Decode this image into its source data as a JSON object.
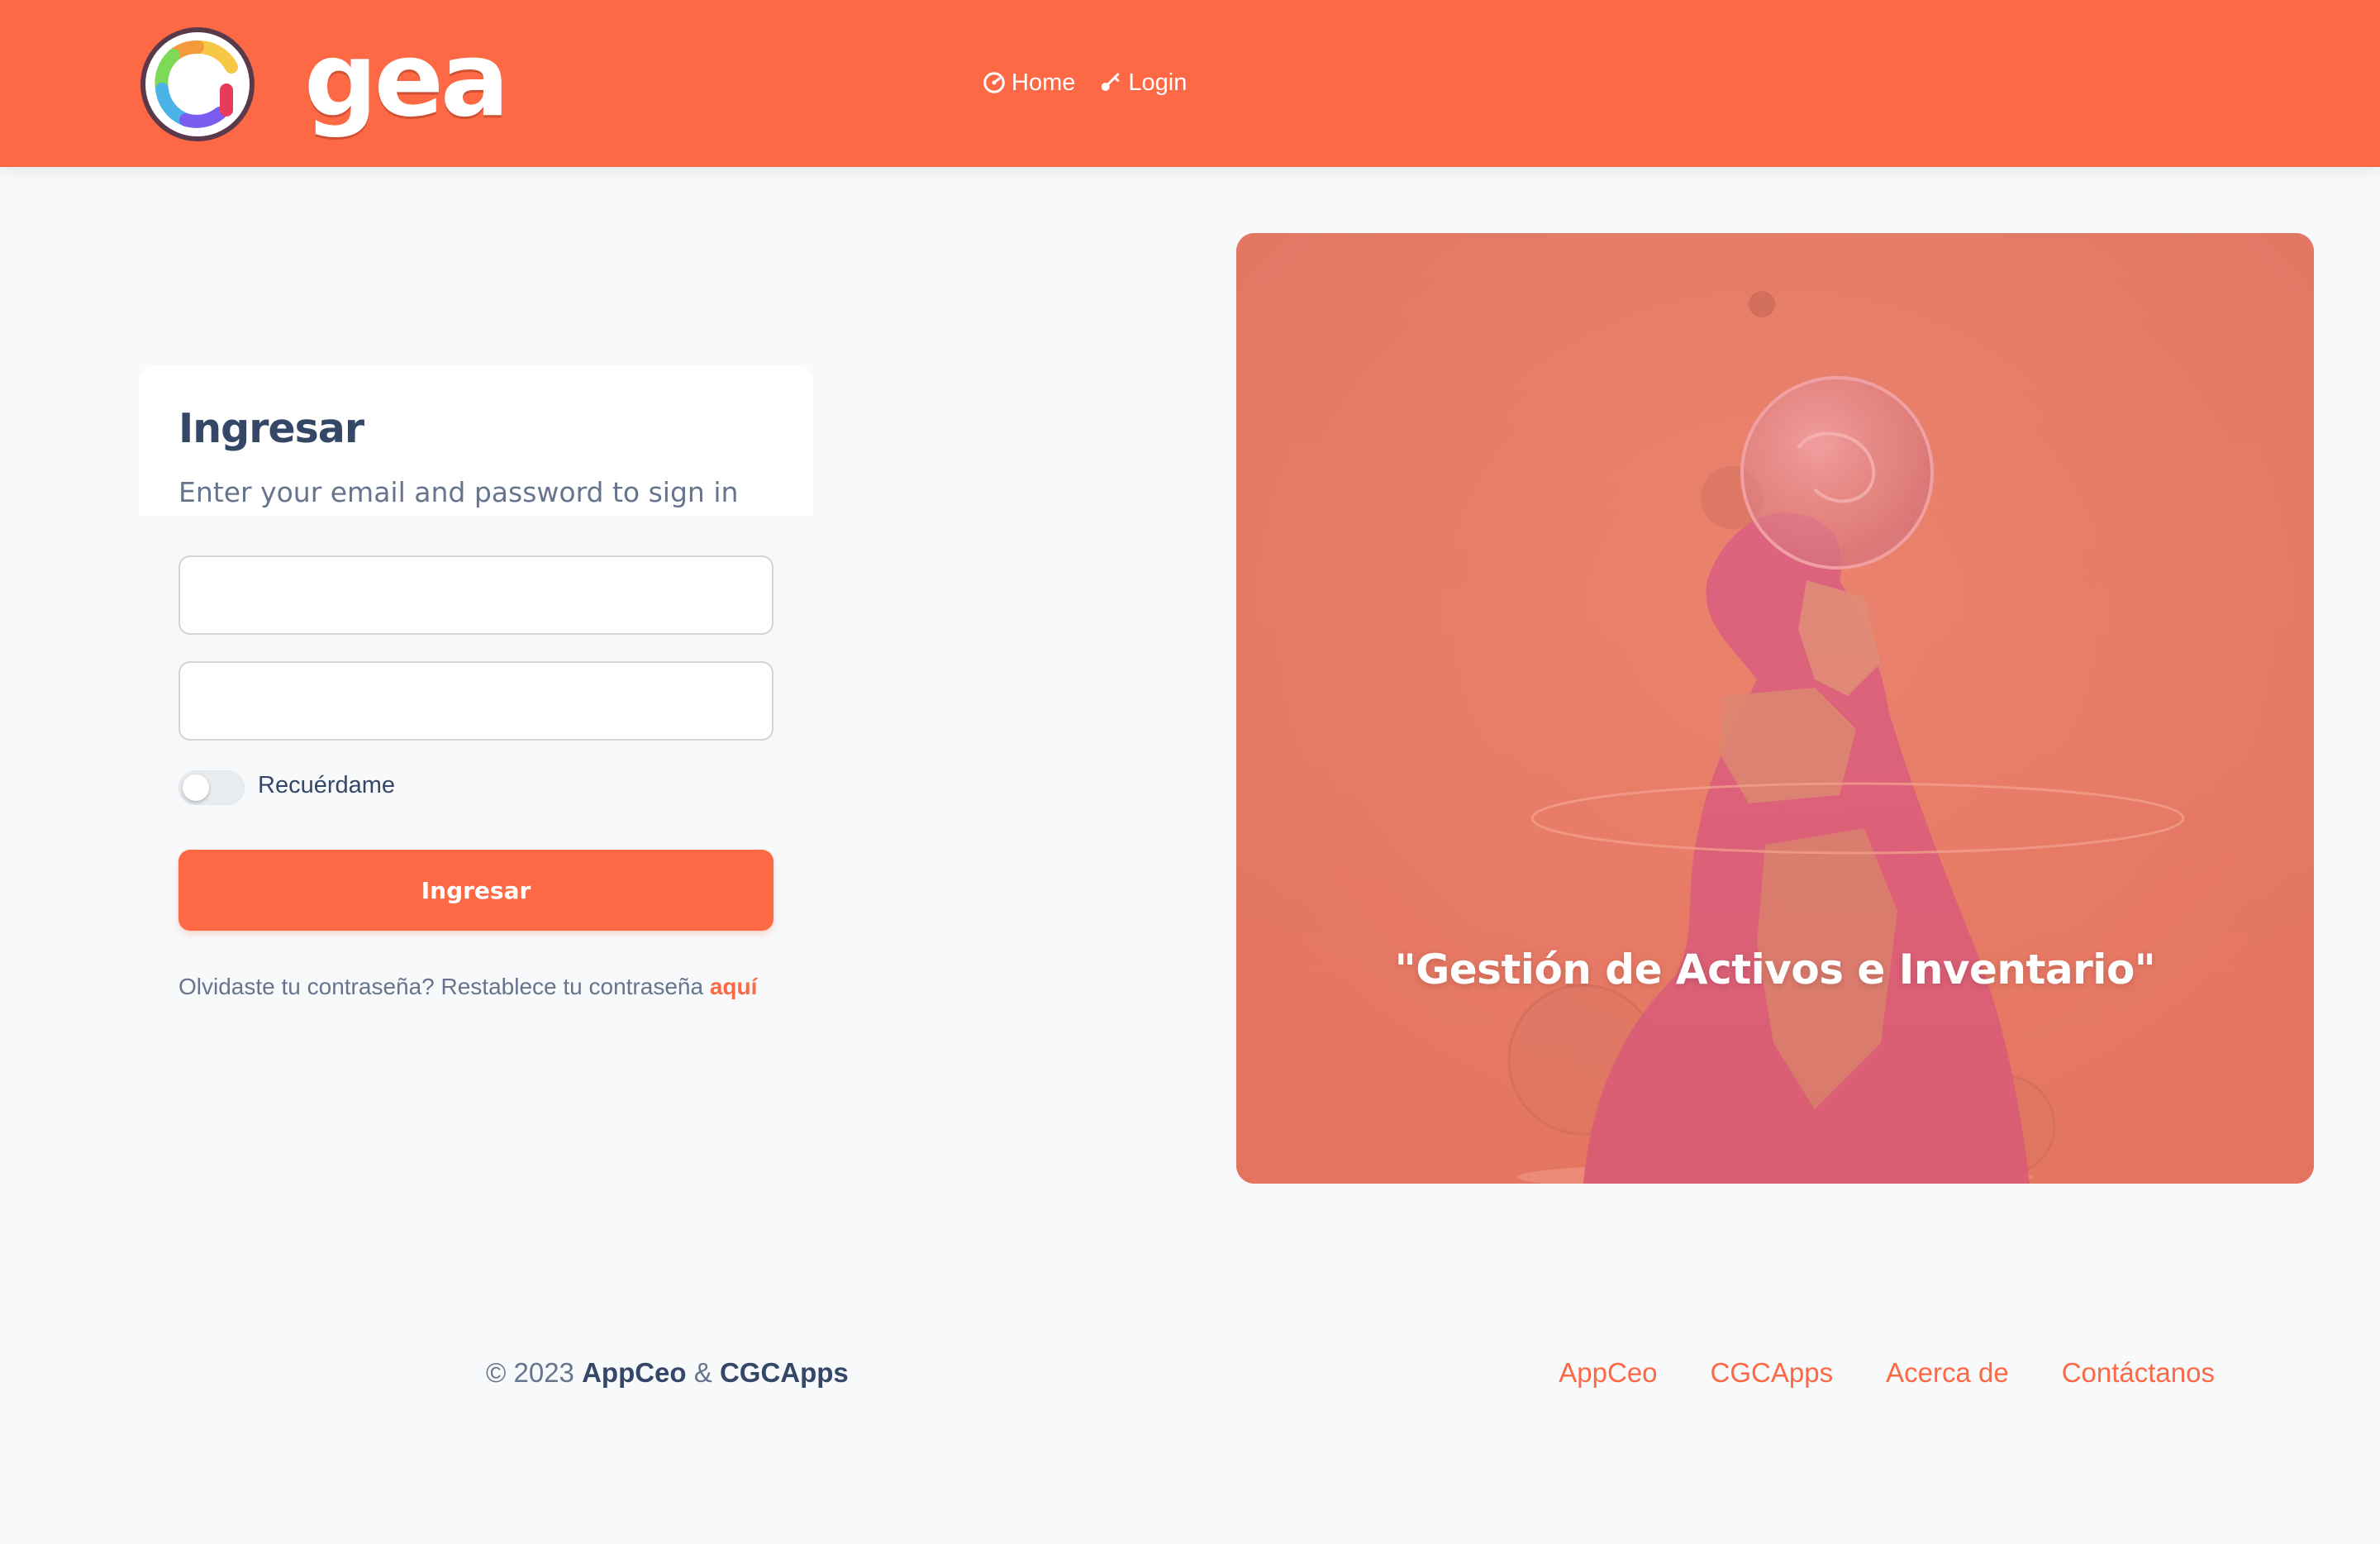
{
  "header": {
    "brand": "gea",
    "nav": [
      {
        "label": "Home",
        "icon": "dashboard-icon"
      },
      {
        "label": "Login",
        "icon": "key-icon"
      }
    ],
    "bg_color": "#fd6845"
  },
  "login": {
    "title": "Ingresar",
    "subtitle": "Enter your email and password to sign in",
    "email": {
      "value": "",
      "placeholder": ""
    },
    "password": {
      "value": "",
      "placeholder": ""
    },
    "remember_label": "Recuérdame",
    "remember_checked": false,
    "submit_label": "Ingresar",
    "forgot_text": "Olvidaste tu contraseña? Restablece tu contraseña",
    "forgot_link": "aquí"
  },
  "hero": {
    "quote": "\"Gestión de Activos e Inventario\""
  },
  "footer": {
    "copyright_prefix": "© 2023",
    "company1": "AppCeo",
    "amp": "&",
    "company2": "CGCApps",
    "links": [
      "AppCeo",
      "CGCApps",
      "Acerca de",
      "Contáctanos"
    ]
  },
  "colors": {
    "accent": "#fd6845",
    "text_dark": "#344767",
    "text_muted": "#67748e"
  }
}
